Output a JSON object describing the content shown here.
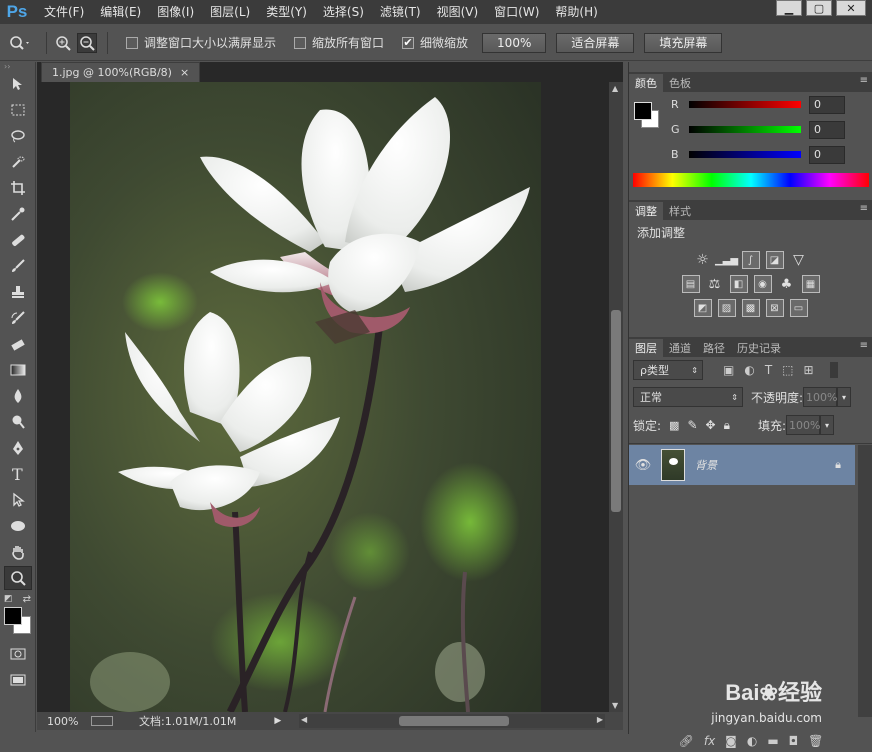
{
  "app": {
    "logo": "Ps"
  },
  "menu": [
    "文件(F)",
    "编辑(E)",
    "图像(I)",
    "图层(L)",
    "类型(Y)",
    "选择(S)",
    "滤镜(T)",
    "视图(V)",
    "窗口(W)",
    "帮助(H)"
  ],
  "window_controls": [
    "▁",
    "▢",
    "✕"
  ],
  "options": {
    "resize_windows": "调整窗口大小以满屏显示",
    "zoom_all": "缩放所有窗口",
    "scrubby_zoom": "细微缩放",
    "zoom_100": "100%",
    "fit_screen": "适合屏幕",
    "fill_screen": "填充屏幕",
    "resize_checked": false,
    "zoom_all_checked": false,
    "scrubby_checked": true
  },
  "document": {
    "tab_title": "1.jpg @ 100%(RGB/8)",
    "close": "×",
    "zoom": "100%",
    "doc_info": "文档:1.01M/1.01M"
  },
  "color_panel": {
    "tabs": [
      "颜色",
      "色板"
    ],
    "r_label": "R",
    "g_label": "G",
    "b_label": "B",
    "r_value": "0",
    "g_value": "0",
    "b_value": "0"
  },
  "adjust_panel": {
    "tabs": [
      "调整",
      "样式"
    ],
    "title": "添加调整"
  },
  "layers_panel": {
    "tabs": [
      "图层",
      "通道",
      "路径",
      "历史记录"
    ],
    "filter_kind": "ρ类型",
    "blend_mode": "正常",
    "opacity_label": "不透明度:",
    "opacity_value": "100%",
    "lock_label": "锁定:",
    "fill_label": "填充:",
    "fill_value": "100%",
    "layer_name": "背景"
  },
  "colors": {
    "accent": "#4ea6e8",
    "layer_selected": "#6d84a3",
    "panel_bg": "#535353",
    "menubar_bg": "#3b3b3b"
  }
}
